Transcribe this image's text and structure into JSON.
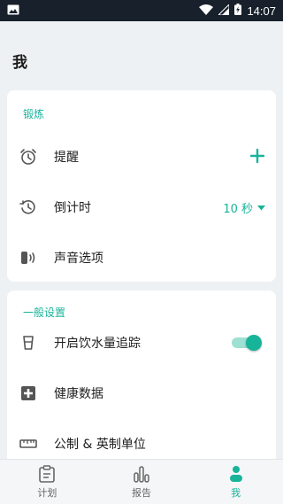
{
  "status_bar": {
    "time": "14:07",
    "icons": [
      "image-icon",
      "wifi-icon",
      "signal-icon",
      "battery-charging-icon"
    ]
  },
  "page": {
    "title": "我"
  },
  "exercise": {
    "header": "锻炼",
    "reminder": {
      "label": "提醒",
      "icon": "alarm-clock-icon",
      "action_icon": "plus-icon"
    },
    "countdown": {
      "label": "倒计时",
      "icon": "history-icon",
      "value": "10 秒",
      "dropdown_icon": "caret-down-icon"
    },
    "sound": {
      "label": "声音选项",
      "icon": "speaker-icon"
    }
  },
  "general": {
    "header": "一般设置",
    "water": {
      "label": "开启饮水量追踪",
      "icon": "cup-icon",
      "enabled": true
    },
    "health": {
      "label": "健康数据",
      "icon": "health-plus-icon"
    },
    "units": {
      "label": "公制 & 英制单位",
      "icon": "ruler-icon"
    }
  },
  "nav": {
    "items": [
      {
        "label": "计划",
        "icon": "clipboard-icon",
        "active": false
      },
      {
        "label": "报告",
        "icon": "bar-chart-icon",
        "active": false
      },
      {
        "label": "我",
        "icon": "person-icon",
        "active": true
      }
    ]
  },
  "colors": {
    "accent": "#18b49a",
    "status_bar": "#17202b",
    "background": "#eef1f4"
  }
}
